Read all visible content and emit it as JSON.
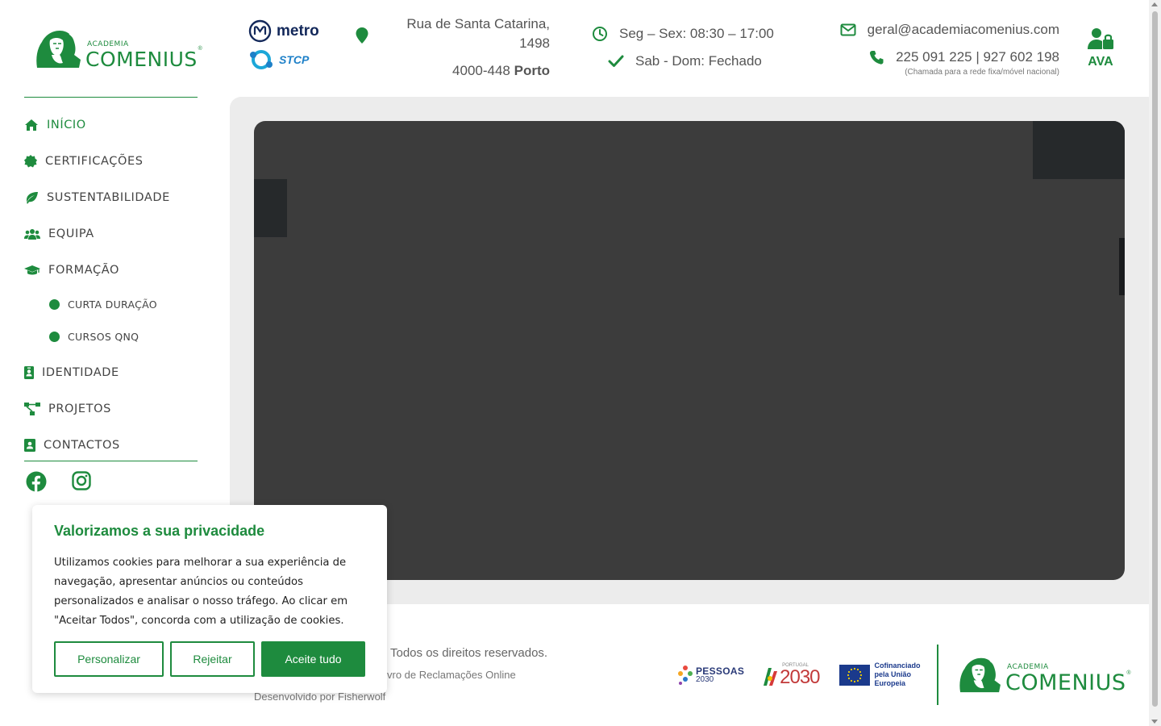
{
  "logo": {
    "small_text": "ACADEMIA",
    "big_text": "COMENIUS",
    "registered": "®"
  },
  "header": {
    "transport": [
      {
        "label": "metro",
        "icon": "metro-logo-icon"
      },
      {
        "label": "STCP",
        "icon": "stcp-logo-icon"
      }
    ],
    "address": {
      "street": "Rua de Santa Catarina, 1498",
      "postal": "4000-448",
      "city": "Porto"
    },
    "hours": {
      "weekdays": "Seg – Sex: 08:30 – 17:00",
      "weekend": "Sab - Dom: Fechado"
    },
    "contact": {
      "email": "geral@academiacomenius.com",
      "phone": "225 091 225 | 927 602 198",
      "phone_note": "(Chamada para a rede fixa/móvel nacional)"
    },
    "ava_label": "AVA"
  },
  "nav": {
    "items": [
      {
        "label": "INÍCIO",
        "icon": "home-icon",
        "active": true
      },
      {
        "label": "CERTIFICAÇÕES",
        "icon": "certificate-icon"
      },
      {
        "label": "SUSTENTABILIDADE",
        "icon": "leaf-icon"
      },
      {
        "label": "EQUIPA",
        "icon": "users-icon"
      },
      {
        "label": "FORMAÇÃO",
        "icon": "graduation-cap-icon"
      },
      {
        "label": "IDENTIDADE",
        "icon": "id-badge-icon"
      },
      {
        "label": "PROJETOS",
        "icon": "project-diagram-icon"
      },
      {
        "label": "CONTACTOS",
        "icon": "address-book-icon"
      }
    ],
    "sub_items": [
      {
        "label": "CURTA DURAÇÃO"
      },
      {
        "label": "CURSOS QNQ"
      }
    ]
  },
  "socials": [
    "facebook-icon",
    "instagram-icon"
  ],
  "footer": {
    "rights": "Todos os direitos reservados.",
    "complaints": "vro de Reclamações Online",
    "developer": "Desenvolvido por Fisherwolf",
    "partners": {
      "pessoas_title": "PESSOAS",
      "pessoas_year": "2030",
      "portugal_small": "PORTUGAL",
      "portugal_year": "2030",
      "eu_text": "Cofinanciado pela União Europeia"
    }
  },
  "cookie": {
    "title": "Valorizamos a sua privacidade",
    "body": "Utilizamos cookies para melhorar a sua experiência de navegação, apresentar anúncios ou conteúdos personalizados e analisar o nosso tráfego. Ao clicar em \"Aceitar Todos\", concorda com a utilização de cookies.",
    "customize_label": "Personalizar",
    "reject_label": "Rejeitar",
    "accept_label": "Aceite tudo"
  },
  "colors": {
    "brand_green": "#1e8b3e",
    "video_bg": "#3c3c3c",
    "main_bg": "#ececec"
  }
}
